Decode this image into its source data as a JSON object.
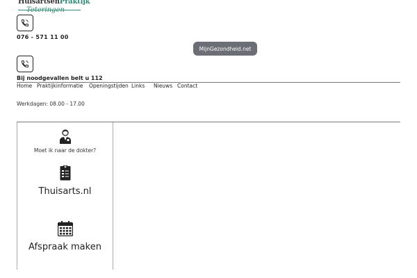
{
  "brand": {
    "name_part1": "Huisartsen",
    "name_part2": "Praktijk",
    "location": "Teteringen"
  },
  "contact": {
    "phone": "076 - 571 11 00",
    "emergency": "Bij noodgevallen belt u 112"
  },
  "header": {
    "external_link": "MijnGezondheid.net"
  },
  "nav": {
    "items": [
      "Home",
      "Praktijkinformatie",
      "Openingstijden",
      "Links",
      "Nieuws",
      "Contact"
    ]
  },
  "hours": {
    "text": "Werkdagen: 08.00 - 17.00"
  },
  "sidebar": {
    "cards": [
      {
        "label": "Moet ik naar de dokter?",
        "icon": "doctor-icon"
      },
      {
        "label": "Thuisarts.nl",
        "icon": "clipboard-icon"
      },
      {
        "label": "Afspraak maken",
        "icon": "calendar-icon"
      }
    ]
  },
  "colors": {
    "brand_green": "#2d8a75",
    "button_gray": "#6b6e74"
  }
}
